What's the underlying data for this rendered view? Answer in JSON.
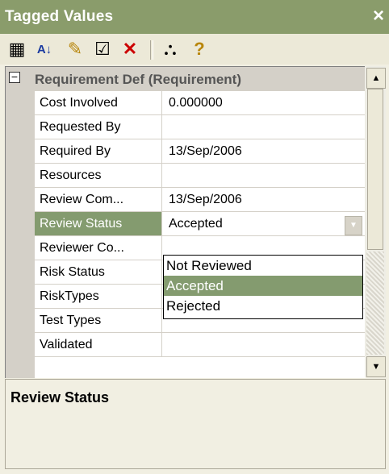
{
  "window": {
    "title": "Tagged Values",
    "close": "×"
  },
  "toolbar": {
    "categorized_icon": "▦",
    "sort_icon": "A↓",
    "new_tag_icon": "✎",
    "properties_icon": "☑",
    "delete_icon": "✕",
    "inherit_icon": "⛬",
    "help_icon": "?"
  },
  "grid": {
    "category": {
      "toggle": "−",
      "label": "Requirement Def (Requirement)"
    },
    "rows": [
      {
        "name": "Cost Involved",
        "value": "0.000000"
      },
      {
        "name": "Requested By",
        "value": ""
      },
      {
        "name": "Required By",
        "value": "13/Sep/2006"
      },
      {
        "name": "Resources",
        "value": ""
      },
      {
        "name": "Review Com...",
        "value": "13/Sep/2006"
      },
      {
        "name": "Review Status",
        "value": "Accepted"
      },
      {
        "name": "Reviewer Co...",
        "value": ""
      },
      {
        "name": "Risk Status",
        "value": ""
      },
      {
        "name": "RiskTypes",
        "value": ""
      },
      {
        "name": "Test Types",
        "value": ""
      },
      {
        "name": "Validated",
        "value": ""
      }
    ],
    "dropdown_options": [
      "Not Reviewed",
      "Accepted",
      "Rejected"
    ],
    "dropdown_arrow": "▼"
  },
  "scrollbar": {
    "up": "▲",
    "down": "▼"
  },
  "description": {
    "title": "Review Status"
  },
  "colors": {
    "titlebar": "#8a9c6b",
    "selection": "#849b6f"
  }
}
